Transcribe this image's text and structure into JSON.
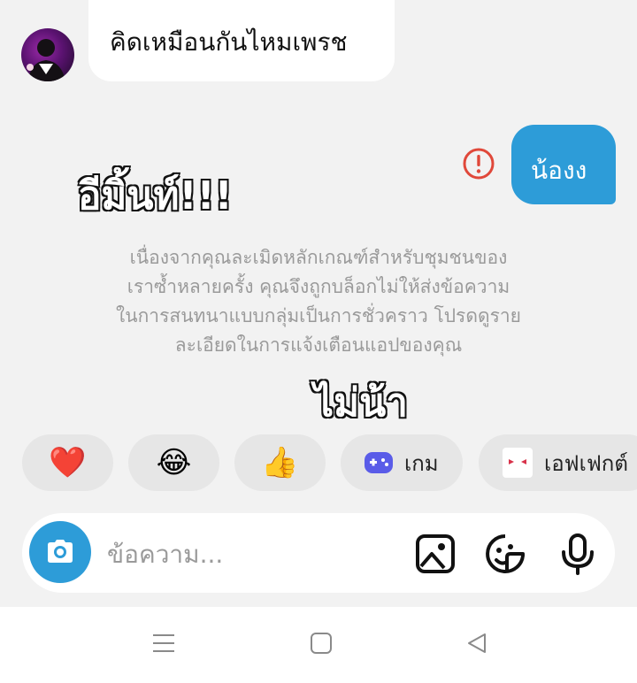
{
  "chat": {
    "incoming_message": "คิดเหมือนกันไหมเพรช",
    "outgoing_message": "น้องง"
  },
  "overlay": {
    "text_1": "อีมิ้นท์!!!",
    "text_2": "ไม่น้า"
  },
  "notice": {
    "lines": [
      "เนื่องจากคุณละเมิดหลักเกณฑ์สำหรับชุมชนของ",
      "เราซ้ำหลายครั้ง คุณจึงถูกบล็อกไม่ให้ส่งข้อความ",
      "ในการสนทนาแบบกลุ่มเป็นการชั่วคราว โปรดดูราย",
      "ละเอียดในการแจ้งเตือนแอปของคุณ"
    ]
  },
  "quick_reactions": [
    {
      "emoji": "❤️",
      "icon": "heart-icon"
    },
    {
      "emoji": "😂",
      "icon": "laughing-face-icon"
    },
    {
      "emoji": "👍",
      "icon": "thumbs-up-icon"
    },
    {
      "label": "เกม",
      "icon": "gamepad-icon"
    },
    {
      "label": "เอฟเฟกต์",
      "icon": "effects-icon"
    }
  ],
  "composer": {
    "placeholder": "ข้อความ..."
  },
  "colors": {
    "accent": "#2d9cd8",
    "error": "#e0483a",
    "background": "#f2f2f2"
  }
}
